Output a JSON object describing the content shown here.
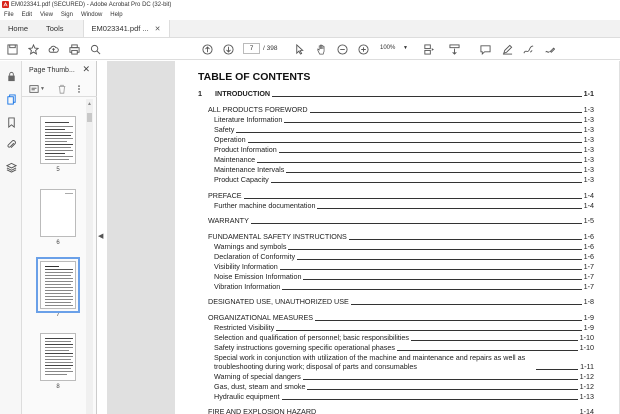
{
  "window": {
    "title": "EM023341.pdf (SECURED) - Adobe Acrobat Pro DC (32-bit)"
  },
  "menu": [
    "File",
    "Edit",
    "View",
    "Sign",
    "Window",
    "Help"
  ],
  "tabs": {
    "home": "Home",
    "tools": "Tools",
    "document": "EM023341.pdf ..."
  },
  "toolbar": {
    "current_page": "7",
    "total_pages": "/ 398",
    "zoom": "100%"
  },
  "thumbnails": {
    "title": "Page Thumb...",
    "pages": [
      {
        "label": "5",
        "selected": false
      },
      {
        "label": "6",
        "selected": false
      },
      {
        "label": "7",
        "selected": true
      },
      {
        "label": "8",
        "selected": false
      }
    ]
  },
  "document": {
    "heading": "TABLE OF CONTENTS",
    "entries": [
      {
        "num": "1",
        "label": "INTRODUCTION",
        "page": "1-1",
        "level": 0,
        "bold": true
      },
      {
        "label": "ALL PRODUCTS FOREWORD",
        "page": "1-3",
        "level": 1
      },
      {
        "label": "Literature Information",
        "page": "1-3",
        "level": 2
      },
      {
        "label": "Safety",
        "page": "1-3",
        "level": 2
      },
      {
        "label": "Operation",
        "page": "1-3",
        "level": 2
      },
      {
        "label": "Product Information",
        "page": "1-3",
        "level": 2
      },
      {
        "label": "Maintenance",
        "page": "1-3",
        "level": 2
      },
      {
        "label": "Maintenance Intervals",
        "page": "1-3",
        "level": 2
      },
      {
        "label": "Product Capacity",
        "page": "1-3",
        "level": 2
      },
      {
        "label": "PREFACE",
        "page": "1-4",
        "level": 1
      },
      {
        "label": "Further machine documentation",
        "page": "1-4",
        "level": 2
      },
      {
        "label": "WARRANTY",
        "page": "1-5",
        "level": 1
      },
      {
        "label": "FUNDAMENTAL SAFETY INSTRUCTIONS",
        "page": "1-6",
        "level": 1
      },
      {
        "label": "Warnings and symbols",
        "page": "1-6",
        "level": 2
      },
      {
        "label": "Declaration of Conformity",
        "page": "1-6",
        "level": 2
      },
      {
        "label": "Visibility Information",
        "page": "1-7",
        "level": 2
      },
      {
        "label": "Noise Emission Information",
        "page": "1-7",
        "level": 2
      },
      {
        "label": "Vibration Information",
        "page": "1-7",
        "level": 2
      },
      {
        "label": "DESIGNATED USE, UNAUTHORIZED USE",
        "page": "1-8",
        "level": 1
      },
      {
        "label": "ORGANIZATIONAL MEASURES",
        "page": "1-9",
        "level": 1
      },
      {
        "label": "Restricted Visibility",
        "page": "1-9",
        "level": 2
      },
      {
        "label": "Selection and qualification of personnel; basic responsibilities",
        "page": "1-10",
        "level": 2
      },
      {
        "label": "Safety instructions governing specific operational phases",
        "page": "1-10",
        "level": 2
      },
      {
        "label": "Special work in conjunction with utilization of the machine and maintenance and repairs as well as troubleshooting during work; disposal of parts and consumables",
        "page": "1-11",
        "level": 2,
        "multiline": true
      },
      {
        "label": "Warning of special dangers",
        "page": "1-12",
        "level": 2
      },
      {
        "label": "Gas, dust, steam and smoke",
        "page": "1-12",
        "level": 2
      },
      {
        "label": "Hydraulic equipment",
        "page": "1-13",
        "level": 2
      },
      {
        "label": "FIRE AND EXPLOSION HAZARD",
        "page": "1-14",
        "level": 1
      }
    ]
  }
}
